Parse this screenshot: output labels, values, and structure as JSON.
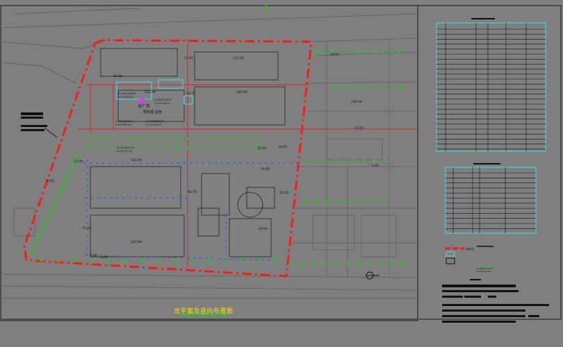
{
  "drawing": {
    "title": "总平面及竖向布置图",
    "plant_name": "水厂名",
    "plant_subname": "预处理 回用",
    "tag_chinese": "北"
  },
  "colors": {
    "background": "#7f7f7f",
    "boundary": "#ff1a1a",
    "pipe_red": "#e02020",
    "pipe_blue": "#2f5bff",
    "tree": "#27c419",
    "cyan": "#3fe0e8",
    "text_yellow": "#ffe200",
    "outline": "#1a1a1a"
  },
  "dimensions": {
    "d1": "15.00",
    "d2": "12.00",
    "d3": "111.00",
    "d4": "113.00",
    "d5": "140.00",
    "d6": "158.00",
    "d7": "143.00",
    "d8": "143.00",
    "d9": "10.70",
    "d10": "60.75",
    "d11": "12.00",
    "d12": "70.00",
    "d13": "15.00",
    "d14": "24.00",
    "d15": "22.00",
    "d16": "71.00",
    "d17": "4.00",
    "d18": "3.00",
    "d19": "20.00",
    "d20": "2.00",
    "d21": "35.00",
    "d22": "20.00",
    "d23": "22.00"
  },
  "coords": {
    "c1": "X=2631716.43",
    "c2": "Y=513702.22",
    "c3": "X=2631716.41",
    "c4": "Y=513710.22",
    "c5": "X=2631606.44",
    "c6": "Y=513707.22",
    "c7": "X=2631606.20",
    "c8": "Y=513700.22",
    "c9": "X=2631590.25",
    "c10": "Y=513715.33"
  },
  "legend": {
    "label_a": "用地红线",
    "label_b": "X=2631716.43",
    "label_c": "Y=513702.22"
  }
}
